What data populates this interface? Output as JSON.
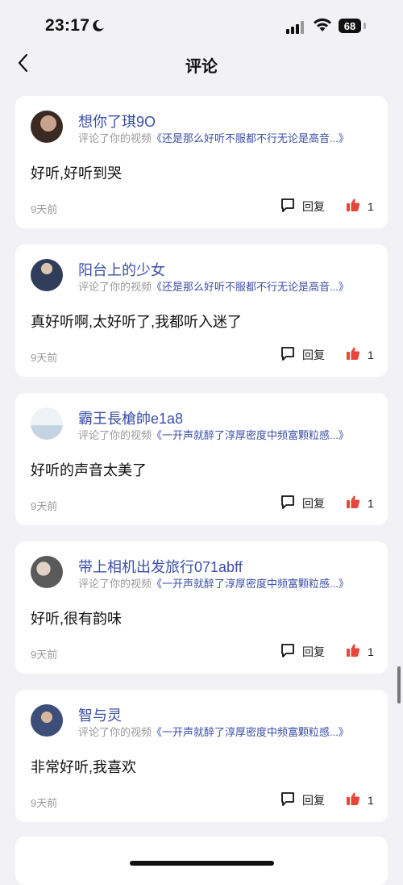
{
  "status": {
    "time": "23:17",
    "battery": "68"
  },
  "header": {
    "title": "评论"
  },
  "reply_label": "回复",
  "items": [
    {
      "username": "想你了琪9O",
      "action": "评论了你的视频",
      "video": "《还是那么好听不服都不行无论是高音...》",
      "comment": "好听,好听到哭",
      "date": "9天前",
      "likes": "1",
      "avatar_color": "#4a3a30"
    },
    {
      "username": "阳台上的少女",
      "action": "评论了你的视频",
      "video": "《还是那么好听不服都不行无论是高音...》",
      "comment": "真好听啊,太好听了,我都听入迷了",
      "date": "9天前",
      "likes": "1",
      "avatar_color": "#2f3d5a"
    },
    {
      "username": "霸王長槍帥e1a8",
      "action": "评论了你的视频",
      "video": "《一开声就醉了淳厚密度中频富颗粒感...》",
      "comment": "好听的声音太美了",
      "date": "9天前",
      "likes": "1",
      "avatar_color": "#d7e3ee"
    },
    {
      "username": "带上相机出发旅行071abff",
      "action": "评论了你的视频",
      "video": "《一开声就醉了淳厚密度中频富颗粒感...》",
      "comment": "好听,很有韵味",
      "date": "9天前",
      "likes": "1",
      "avatar_color": "#5a5a5a"
    },
    {
      "username": "智与灵",
      "action": "评论了你的视频",
      "video": "《一开声就醉了淳厚密度中频富颗粒感...》",
      "comment": "非常好听,我喜欢",
      "date": "9天前",
      "likes": "1",
      "avatar_color": "#3d4e78"
    }
  ],
  "colors": {
    "accent": "#3b4fa8",
    "like": "#e8463c",
    "background": "#f2f2f6"
  }
}
